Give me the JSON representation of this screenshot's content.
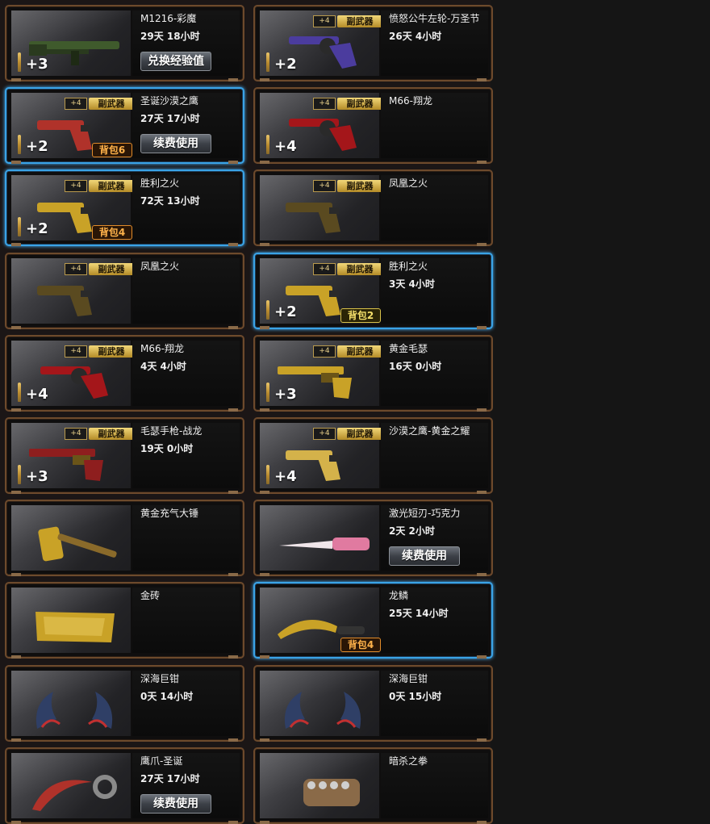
{
  "items": [
    {
      "name": "M1216-彩魔",
      "time": "29天 18小时",
      "button": "兑换经验值",
      "upgrade": "+3",
      "show_secondary": false,
      "bag": "",
      "selected": false,
      "icon": "shotgun-icon",
      "color": "#3f5a2c"
    },
    {
      "name": "愤怒公牛左轮-万圣节",
      "time": "26天 4小时",
      "button": "",
      "upgrade": "+2",
      "show_secondary": true,
      "bag": "",
      "selected": false,
      "icon": "revolver-icon",
      "color": "#4b3c9e"
    },
    {
      "name": "圣诞沙漠之鹰",
      "time": "27天 17小时",
      "button": "续费使用",
      "upgrade": "+2",
      "show_secondary": true,
      "bag": "背包6",
      "bag_style": "orange",
      "selected": true,
      "icon": "pistol-icon",
      "color": "#b0322a"
    },
    {
      "name": "M66-翔龙",
      "time": "",
      "button": "",
      "upgrade": "+4",
      "show_secondary": true,
      "bag": "",
      "selected": false,
      "icon": "revolver-icon",
      "color": "#a4161a"
    },
    {
      "name": "胜利之火",
      "time": "72天 13小时",
      "button": "",
      "upgrade": "+2",
      "show_secondary": true,
      "bag": "背包4",
      "bag_style": "orange",
      "selected": true,
      "icon": "pistol-icon",
      "color": "#c9a227"
    },
    {
      "name": "凤凰之火",
      "time": "",
      "button": "",
      "upgrade": "",
      "show_secondary": true,
      "bag": "",
      "selected": false,
      "icon": "pistol-icon",
      "color": "#5a4a20"
    },
    {
      "name": "凤凰之火",
      "time": "",
      "button": "",
      "upgrade": "",
      "show_secondary": true,
      "bag": "",
      "selected": false,
      "icon": "pistol-icon",
      "color": "#5a4a20"
    },
    {
      "name": "胜利之火",
      "time": "3天 4小时",
      "button": "",
      "upgrade": "+2",
      "show_secondary": true,
      "bag": "背包2",
      "bag_style": "yellow",
      "selected": true,
      "icon": "pistol-icon",
      "color": "#c9a227"
    },
    {
      "name": "M66-翔龙",
      "time": "4天 4小时",
      "button": "",
      "upgrade": "+4",
      "show_secondary": true,
      "bag": "",
      "selected": false,
      "icon": "revolver-icon",
      "color": "#a4161a"
    },
    {
      "name": "黄金毛瑟",
      "time": "16天 0小时",
      "button": "",
      "upgrade": "+3",
      "show_secondary": true,
      "bag": "",
      "selected": false,
      "icon": "mauser-icon",
      "color": "#c9a227"
    },
    {
      "name": "毛瑟手枪-战龙",
      "time": "19天 0小时",
      "button": "",
      "upgrade": "+3",
      "show_secondary": true,
      "bag": "",
      "selected": false,
      "icon": "mauser-icon",
      "color": "#8e1e1e"
    },
    {
      "name": "沙漠之鹰-黄金之耀",
      "time": "",
      "button": "",
      "upgrade": "+4",
      "show_secondary": true,
      "bag": "",
      "selected": false,
      "icon": "pistol-icon",
      "color": "#d4b24a"
    },
    {
      "name": "黄金充气大锤",
      "time": "",
      "button": "",
      "upgrade": "",
      "show_secondary": false,
      "bag": "",
      "selected": false,
      "icon": "hammer-icon",
      "color": "#c9a227"
    },
    {
      "name": "激光短刃-巧克力",
      "time": "2天 2小时",
      "button": "续费使用",
      "upgrade": "",
      "show_secondary": false,
      "bag": "",
      "selected": false,
      "icon": "blade-icon",
      "color": "#e07aa0"
    },
    {
      "name": "金砖",
      "time": "",
      "button": "",
      "upgrade": "",
      "show_secondary": false,
      "bag": "",
      "selected": false,
      "icon": "gold-brick-icon",
      "color": "#c9a227"
    },
    {
      "name": "龙鳞",
      "time": "25天 14小时",
      "button": "",
      "upgrade": "",
      "show_secondary": false,
      "bag": "背包4",
      "bag_style": "orange",
      "selected": true,
      "icon": "kukri-icon",
      "color": "#c9a227"
    },
    {
      "name": "深海巨钳",
      "time": "0天 14小时",
      "button": "",
      "upgrade": "",
      "show_secondary": false,
      "bag": "",
      "selected": false,
      "icon": "claws-icon",
      "color": "#2f3f66"
    },
    {
      "name": "深海巨钳",
      "time": "0天 15小时",
      "button": "",
      "upgrade": "",
      "show_secondary": false,
      "bag": "",
      "selected": false,
      "icon": "claws-icon",
      "color": "#2f3f66"
    },
    {
      "name": "鹰爪-圣诞",
      "time": "27天 17小时",
      "button": "续费使用",
      "upgrade": "",
      "show_secondary": false,
      "bag": "",
      "selected": false,
      "icon": "karambit-icon",
      "color": "#b0322a"
    },
    {
      "name": "暗杀之拳",
      "time": "",
      "button": "",
      "upgrade": "",
      "show_secondary": false,
      "bag": "",
      "selected": false,
      "icon": "knuckle-icon",
      "color": "#8a6a48"
    }
  ],
  "labels": {
    "secondary_weapon": "副武器",
    "level_tag": "+4"
  }
}
